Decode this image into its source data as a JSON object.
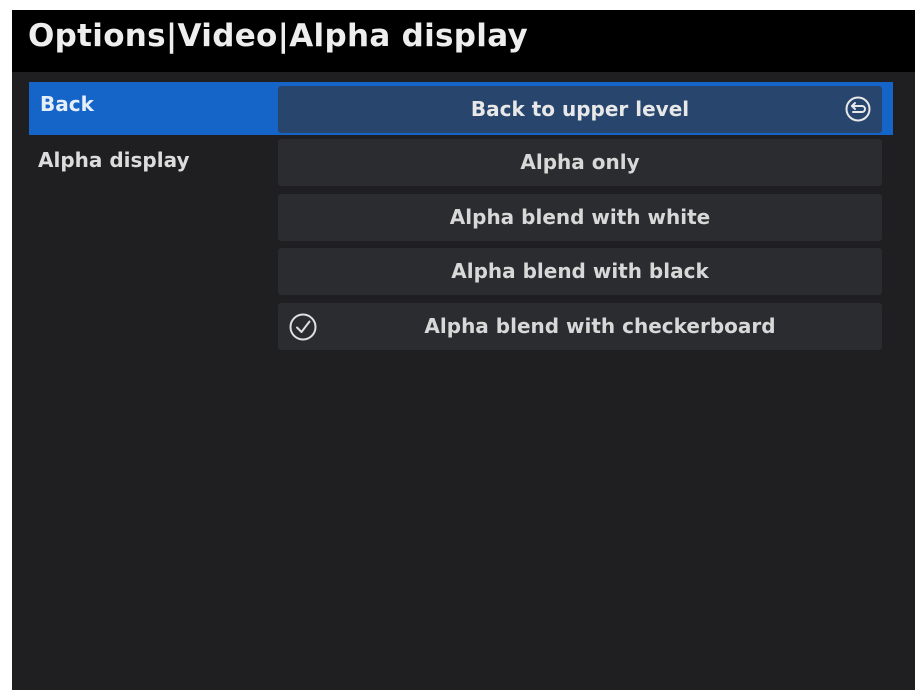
{
  "title": "Options|Video|Alpha display",
  "rows": {
    "back_label": "Back",
    "alpha_label": "Alpha display"
  },
  "options": {
    "back": "Back to upper level",
    "alpha_only": "Alpha only",
    "blend_white": "Alpha blend with white",
    "blend_black": "Alpha blend with black",
    "blend_checkerboard": "Alpha blend with checkerboard"
  },
  "icons": {
    "back": "return-arrow-icon",
    "checked": "checkmark-circle-icon"
  },
  "colors": {
    "highlight": "#1565c8",
    "selected_option": "#27456d",
    "option_bg": "#2b2c2f",
    "background": "#1f1f21",
    "titlebar": "#000000"
  }
}
